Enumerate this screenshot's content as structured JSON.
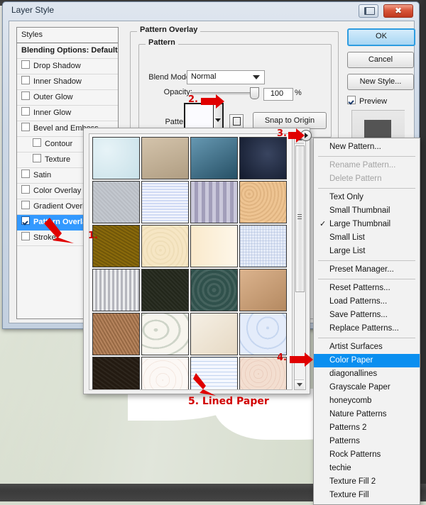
{
  "window": {
    "title": "Layer Style",
    "restore_icon": "restore-icon",
    "close_icon": "close-icon",
    "close_glyph": "✖"
  },
  "styles_panel": {
    "header": "Styles",
    "items": [
      {
        "label": "Blending Options: Default",
        "checkbox": false,
        "has_checkbox": false,
        "indent": false,
        "selected": false,
        "bold": false
      },
      {
        "label": "Drop Shadow",
        "checkbox": false,
        "has_checkbox": true,
        "indent": false,
        "selected": false,
        "bold": false
      },
      {
        "label": "Inner Shadow",
        "checkbox": false,
        "has_checkbox": true,
        "indent": false,
        "selected": false,
        "bold": false
      },
      {
        "label": "Outer Glow",
        "checkbox": false,
        "has_checkbox": true,
        "indent": false,
        "selected": false,
        "bold": false
      },
      {
        "label": "Inner Glow",
        "checkbox": false,
        "has_checkbox": true,
        "indent": false,
        "selected": false,
        "bold": false
      },
      {
        "label": "Bevel and Emboss",
        "checkbox": false,
        "has_checkbox": true,
        "indent": false,
        "selected": false,
        "bold": false
      },
      {
        "label": "Contour",
        "checkbox": false,
        "has_checkbox": true,
        "indent": true,
        "selected": false,
        "bold": false
      },
      {
        "label": "Texture",
        "checkbox": false,
        "has_checkbox": true,
        "indent": true,
        "selected": false,
        "bold": false
      },
      {
        "label": "Satin",
        "checkbox": false,
        "has_checkbox": true,
        "indent": false,
        "selected": false,
        "bold": false
      },
      {
        "label": "Color Overlay",
        "checkbox": false,
        "has_checkbox": true,
        "indent": false,
        "selected": false,
        "bold": false
      },
      {
        "label": "Gradient Overlay",
        "checkbox": false,
        "has_checkbox": true,
        "indent": false,
        "selected": false,
        "bold": false
      },
      {
        "label": "Pattern Overlay",
        "checkbox": true,
        "has_checkbox": true,
        "indent": false,
        "selected": true,
        "bold": true
      },
      {
        "label": "Stroke",
        "checkbox": false,
        "has_checkbox": true,
        "indent": false,
        "selected": false,
        "bold": false
      }
    ]
  },
  "pattern_overlay": {
    "group_title": "Pattern Overlay",
    "subgroup_title": "Pattern",
    "blend_mode_label": "Blend Mode:",
    "blend_mode_value": "Normal",
    "opacity_label": "Opacity:",
    "opacity_value": "100",
    "opacity_unit": "%",
    "pattern_label": "Pattern:",
    "pattern_dropdown_icon": "chevron-down-icon",
    "new_preset_icon": "new-preset-icon",
    "snap_to_origin": "Snap to Origin"
  },
  "buttons": {
    "ok": "OK",
    "cancel": "Cancel",
    "new_style": "New Style...",
    "preview_label": "Preview",
    "preview_checked": true
  },
  "picker": {
    "menu_button_icon": "triangle-right-icon",
    "scroll_up_icon": "scroll-up-arrow-icon",
    "scroll_down_icon": "scroll-down-arrow-icon",
    "swatch_rows": [
      [
        {
          "name": "light-blue-paper",
          "color": "#cfe8f0"
        },
        {
          "name": "tan-paper",
          "color": "#c8b394"
        },
        {
          "name": "teal-blue-paper",
          "color": "#3b7b9c"
        },
        {
          "name": "dark-navy-paper",
          "color": "#1e2b4a"
        }
      ],
      [
        {
          "name": "gray-speckle-paper",
          "color": "#c3c8cf"
        },
        {
          "name": "pale-blue-paper",
          "color": "#d6dff7"
        },
        {
          "name": "lavender-stripe-paper",
          "color": "#aeaac8"
        },
        {
          "name": "peach-cork-paper",
          "color": "#eec492"
        }
      ],
      [
        {
          "name": "dark-gold-paper",
          "color": "#8a6a0b"
        },
        {
          "name": "cream-paper",
          "color": "#f6e6c4"
        },
        {
          "name": "ivory-paper",
          "color": "#fdf1da"
        },
        {
          "name": "white-grid-paper",
          "color": "#e6ecf8"
        }
      ],
      [
        {
          "name": "gray-corrugated-paper",
          "color": "#c9cbd2"
        },
        {
          "name": "black-green-paper",
          "color": "#22261a"
        },
        {
          "name": "dark-teal-paper",
          "color": "#30514c"
        },
        {
          "name": "light-brown-paper",
          "color": "#d2a071"
        }
      ],
      [
        {
          "name": "brown-texture-paper",
          "color": "#b07a4f"
        },
        {
          "name": "confetti-fiber-paper",
          "color": "#f7f5ee"
        },
        {
          "name": "beige-paper",
          "color": "#f0e6d4"
        },
        {
          "name": "pale-blue-floral-paper",
          "color": "#e4ecfa"
        }
      ],
      [
        {
          "name": "dark-brown-paper",
          "color": "#231a11"
        },
        {
          "name": "white-speckle-paper",
          "color": "#fcf8f5"
        },
        {
          "name": "lined-paper",
          "color": "#f4f7fe"
        },
        {
          "name": "pink-beige-paper",
          "color": "#f3ded0"
        }
      ]
    ]
  },
  "context_menu": {
    "items": [
      {
        "label": "New Pattern...",
        "disabled": false,
        "checked": false,
        "selected": false,
        "separator_after": true
      },
      {
        "label": "Rename Pattern...",
        "disabled": true,
        "checked": false,
        "selected": false,
        "separator_after": false
      },
      {
        "label": "Delete Pattern",
        "disabled": true,
        "checked": false,
        "selected": false,
        "separator_after": true
      },
      {
        "label": "Text Only",
        "disabled": false,
        "checked": false,
        "selected": false,
        "separator_after": false
      },
      {
        "label": "Small Thumbnail",
        "disabled": false,
        "checked": false,
        "selected": false,
        "separator_after": false
      },
      {
        "label": "Large Thumbnail",
        "disabled": false,
        "checked": true,
        "selected": false,
        "separator_after": false
      },
      {
        "label": "Small List",
        "disabled": false,
        "checked": false,
        "selected": false,
        "separator_after": false
      },
      {
        "label": "Large List",
        "disabled": false,
        "checked": false,
        "selected": false,
        "separator_after": true
      },
      {
        "label": "Preset Manager...",
        "disabled": false,
        "checked": false,
        "selected": false,
        "separator_after": true
      },
      {
        "label": "Reset Patterns...",
        "disabled": false,
        "checked": false,
        "selected": false,
        "separator_after": false
      },
      {
        "label": "Load Patterns...",
        "disabled": false,
        "checked": false,
        "selected": false,
        "separator_after": false
      },
      {
        "label": "Save Patterns...",
        "disabled": false,
        "checked": false,
        "selected": false,
        "separator_after": false
      },
      {
        "label": "Replace Patterns...",
        "disabled": false,
        "checked": false,
        "selected": false,
        "separator_after": true
      },
      {
        "label": "Artist Surfaces",
        "disabled": false,
        "checked": false,
        "selected": false,
        "separator_after": false
      },
      {
        "label": "Color Paper",
        "disabled": false,
        "checked": false,
        "selected": true,
        "separator_after": false
      },
      {
        "label": "diagonallines",
        "disabled": false,
        "checked": false,
        "selected": false,
        "separator_after": false
      },
      {
        "label": "Grayscale Paper",
        "disabled": false,
        "checked": false,
        "selected": false,
        "separator_after": false
      },
      {
        "label": "honeycomb",
        "disabled": false,
        "checked": false,
        "selected": false,
        "separator_after": false
      },
      {
        "label": "Nature Patterns",
        "disabled": false,
        "checked": false,
        "selected": false,
        "separator_after": false
      },
      {
        "label": "Patterns 2",
        "disabled": false,
        "checked": false,
        "selected": false,
        "separator_after": false
      },
      {
        "label": "Patterns",
        "disabled": false,
        "checked": false,
        "selected": false,
        "separator_after": false
      },
      {
        "label": "Rock Patterns",
        "disabled": false,
        "checked": false,
        "selected": false,
        "separator_after": false
      },
      {
        "label": "techie",
        "disabled": false,
        "checked": false,
        "selected": false,
        "separator_after": false
      },
      {
        "label": "Texture Fill 2",
        "disabled": false,
        "checked": false,
        "selected": false,
        "separator_after": false
      },
      {
        "label": "Texture Fill",
        "disabled": false,
        "checked": false,
        "selected": false,
        "separator_after": false
      }
    ],
    "check_glyph": "✓"
  },
  "annotations": {
    "step1": "1.",
    "step2": "2.",
    "step3": "3.",
    "step4": "4.",
    "step5": "5. Lined Paper",
    "accent_color": "#d20000"
  }
}
